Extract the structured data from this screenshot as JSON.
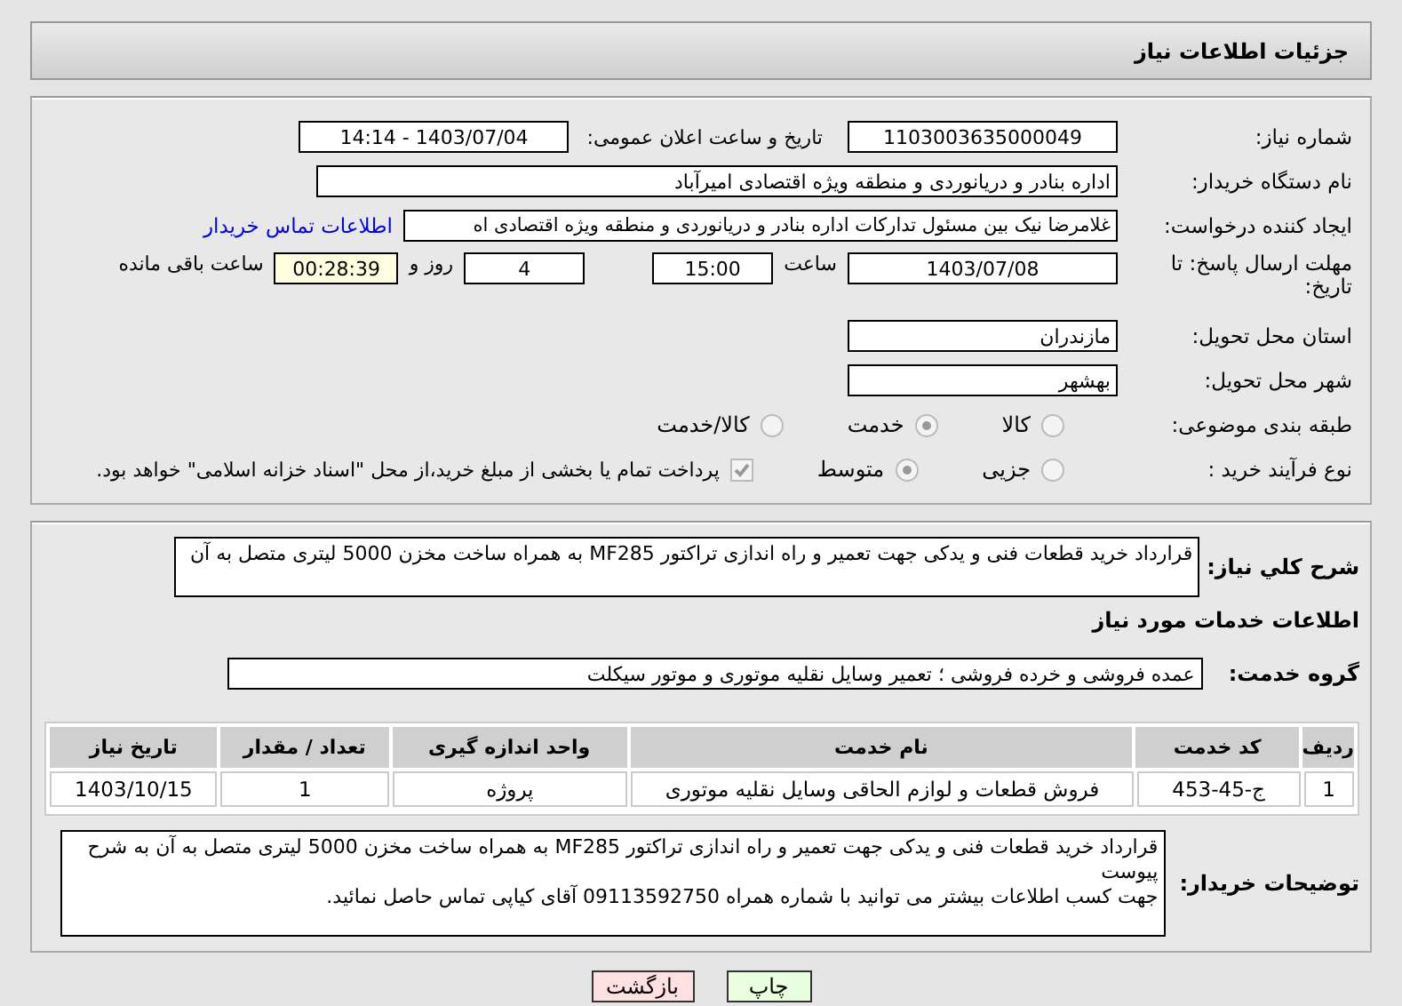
{
  "header": {
    "title": "جزئیات اطلاعات نیاز"
  },
  "need_number": {
    "label": "شماره نیاز:",
    "value": "1103003635000049"
  },
  "announce": {
    "label": "تاریخ و ساعت اعلان عمومی:",
    "value": "1403/07/04 - 14:14"
  },
  "buyer": {
    "label": "نام دستگاه خریدار:",
    "value": "اداره بنادر و دریانوردی و منطقه ویژه اقتصادی امیرآباد"
  },
  "creator": {
    "label": "ایجاد کننده درخواست:",
    "value": "غلامرضا نیک بین مسئول تدارکات اداره بنادر و دریانوردی و منطقه ویژه اقتصادی اه",
    "link": "اطلاعات تماس خریدار"
  },
  "deadline": {
    "label": "مهلت ارسال پاسخ: تا تاریخ:",
    "date": "1403/07/08",
    "time_label": "ساعت",
    "time": "15:00",
    "days": "4",
    "days_label": "روز و",
    "remaining": "00:28:39",
    "remaining_label": "ساعت باقی مانده"
  },
  "province": {
    "label": "استان محل تحویل:",
    "value": "مازندران"
  },
  "city": {
    "label": "شهر محل تحویل:",
    "value": "بهشهر"
  },
  "category": {
    "label": "طبقه بندی موضوعی:",
    "options": [
      {
        "label": "کالا",
        "selected": false
      },
      {
        "label": "خدمت",
        "selected": true
      },
      {
        "label": "کالا/خدمت",
        "selected": false
      }
    ]
  },
  "process": {
    "label": "نوع فرآیند خرید :",
    "options": [
      {
        "label": "جزیی",
        "selected": false
      },
      {
        "label": "متوسط",
        "selected": true
      }
    ],
    "payment": {
      "checked": true,
      "label": "پرداخت تمام یا بخشی از مبلغ خرید،از محل \"اسناد خزانه اسلامی\" خواهد بود."
    }
  },
  "summary": {
    "label": "شرح کلي نیاز:",
    "value": "قرارداد خرید قطعات فنی و یدکی جهت تعمیر و راه اندازی تراکتور MF285 به همراه ساخت مخزن 5000 لیتری متصل به آن"
  },
  "services_title": "اطلاعات خدمات مورد نیاز",
  "service_group": {
    "label": "گروه خدمت:",
    "value": "عمده فروشی و خرده فروشی ؛ تعمیر وسایل نقلیه موتوری و موتور سیکلت"
  },
  "table": {
    "columns": [
      "ردیف",
      "کد خدمت",
      "نام خدمت",
      "واحد اندازه گیری",
      "تعداد / مقدار",
      "تاریخ نیاز"
    ],
    "rows": [
      [
        "1",
        "ج-45-453",
        "فروش قطعات و لوازم الحاقی وسایل نقلیه موتوری",
        "پروژه",
        "1",
        "1403/10/15"
      ]
    ]
  },
  "notes": {
    "label": "توضیحات خریدار:",
    "lines": [
      "قرارداد خرید قطعات فنی و یدکی جهت تعمیر و راه اندازی تراکتور MF285 به همراه ساخت مخزن 5000 لیتری متصل به آن به شرح پیوست",
      "جهت کسب اطلاعات بیشتر می توانید با شماره همراه 09113592750 آقای کیاپی تماس حاصل نمائید."
    ]
  },
  "buttons": [
    {
      "kind": "print",
      "label": "چاپ"
    },
    {
      "kind": "back",
      "label": "بازگشت"
    }
  ]
}
